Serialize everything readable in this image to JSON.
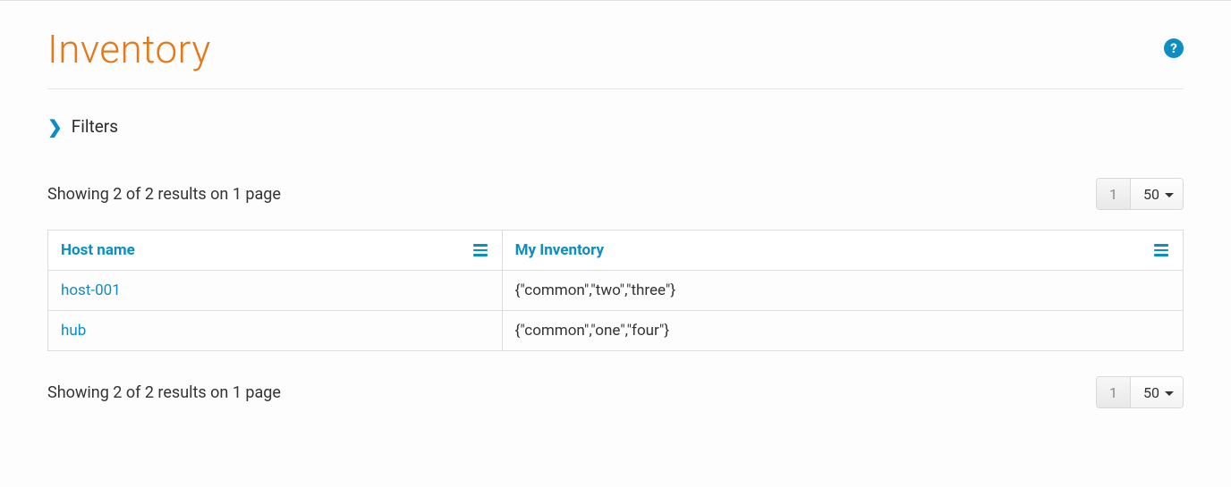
{
  "page": {
    "title": "Inventory"
  },
  "filters": {
    "label": "Filters"
  },
  "results": {
    "summary_top": "Showing 2 of 2 results on 1 page",
    "summary_bottom": "Showing 2 of 2 results on 1 page"
  },
  "pager_top": {
    "current_page": "1",
    "page_size": "50"
  },
  "pager_bottom": {
    "current_page": "1",
    "page_size": "50"
  },
  "table": {
    "columns": {
      "hostname": "Host name",
      "inventory": "My Inventory"
    },
    "rows": [
      {
        "hostname": "host-001",
        "inventory": "{\"common\",\"two\",\"three\"}"
      },
      {
        "hostname": "hub",
        "inventory": "{\"common\",\"one\",\"four\"}"
      }
    ]
  },
  "help": {
    "glyph": "?"
  }
}
